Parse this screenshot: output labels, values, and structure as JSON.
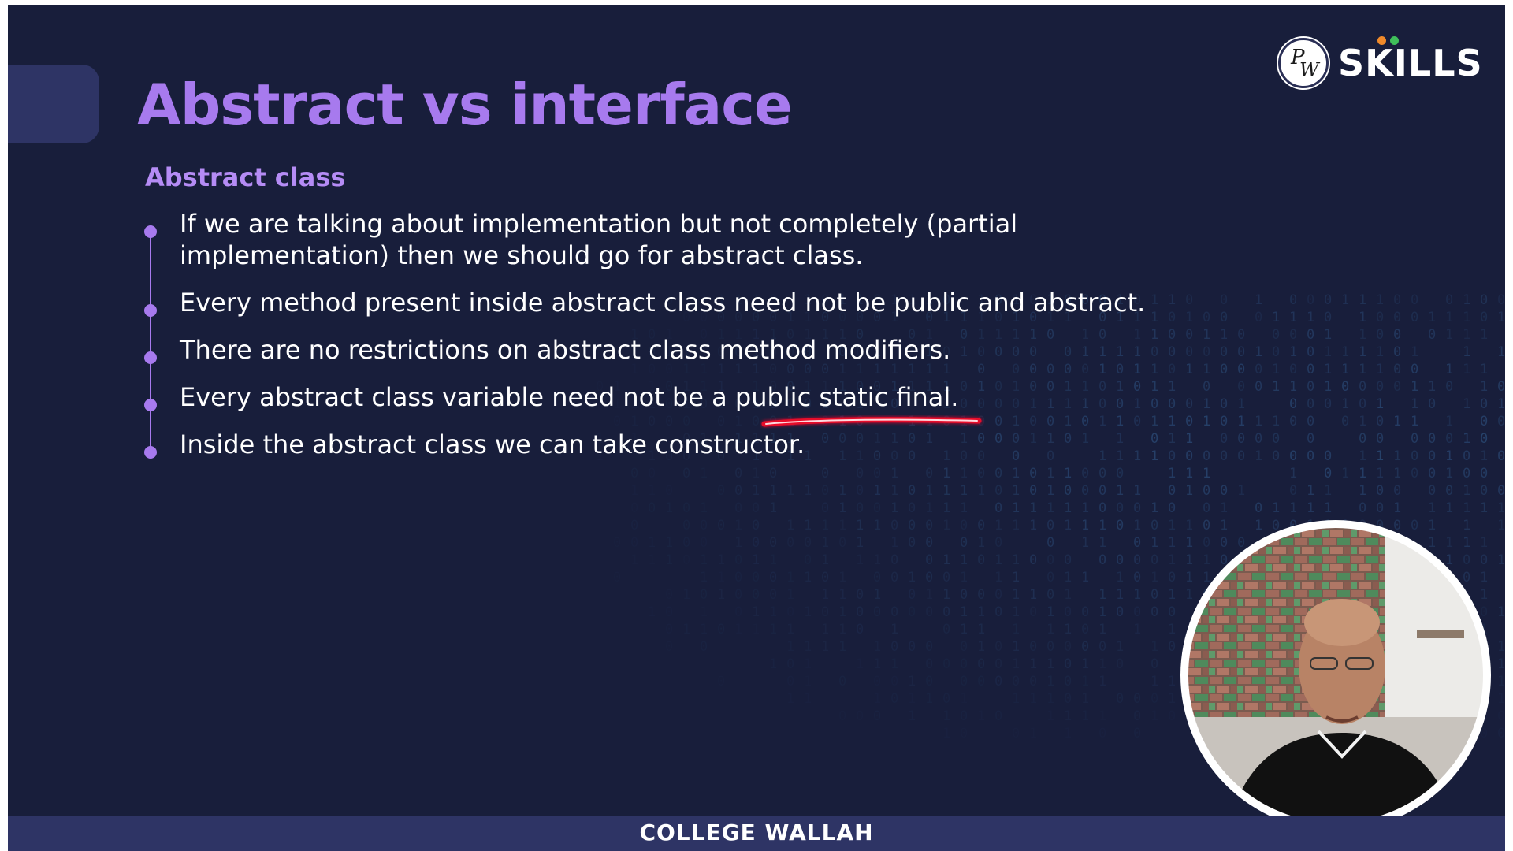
{
  "slide": {
    "title": "Abstract vs interface",
    "section_label": "Abstract class",
    "bullets": [
      "If we are talking about implementation but not completely (partial implementation) then we should go for abstract class.",
      "Every method present inside abstract class need not be public and abstract.",
      "There are no restrictions on abstract class method modifiers.",
      "Every abstract class variable need not be a public static final.",
      "Inside the abstract class we can take constructor."
    ],
    "underlined_phrase": "public static final"
  },
  "logo": {
    "monogram": "PW",
    "text": "SKILLS"
  },
  "footer": {
    "text": "COLLEGE WALLAH"
  },
  "colors": {
    "background": "#181e3b",
    "accent": "#a77aee",
    "text": "#ffffff",
    "footer_bar": "#2e3465",
    "underline": "#e8102a"
  },
  "icons": {
    "bullet": "circle-bullet-icon",
    "logo": "pw-logo-icon"
  }
}
